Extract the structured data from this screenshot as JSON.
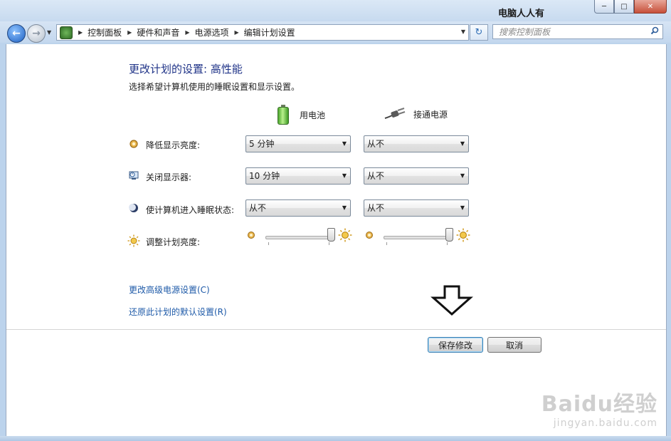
{
  "window": {
    "watermark_title": "电脑人人有",
    "controls": {
      "minimize": "─",
      "maximize": "□",
      "close": "✕"
    }
  },
  "nav": {
    "back_icon": "back-arrow-icon",
    "forward_icon": "forward-arrow-icon",
    "breadcrumbs": [
      "控制面板",
      "硬件和声音",
      "电源选项",
      "编辑计划设置"
    ],
    "search_placeholder": "搜索控制面板"
  },
  "page": {
    "title": "更改计划的设置: 高性能",
    "subtitle": "选择希望计算机使用的睡眠设置和显示设置。",
    "columns": {
      "battery": {
        "label": "用电池",
        "icon": "battery-icon"
      },
      "plugged": {
        "label": "接通电源",
        "icon": "plug-icon"
      }
    },
    "settings": [
      {
        "label": "降低显示亮度:",
        "icon": "dim-brightness-icon",
        "battery": "5 分钟",
        "plugged": "从不"
      },
      {
        "label": "关闭显示器:",
        "icon": "monitor-clock-icon",
        "battery": "10 分钟",
        "plugged": "从不"
      },
      {
        "label": "使计算机进入睡眠状态:",
        "icon": "moon-sleep-icon",
        "battery": "从不",
        "plugged": "从不"
      }
    ],
    "brightness": {
      "label": "调整计划亮度:",
      "icon": "sun-icon",
      "battery_level": 1.0,
      "plugged_level": 1.0
    },
    "links": {
      "advanced": "更改高级电源设置(C)",
      "restore": "还原此计划的默认设置(R)"
    },
    "buttons": {
      "save": "保存修改",
      "cancel": "取消"
    }
  },
  "watermark": {
    "logo": "Baidu经验",
    "url": "jingyan.baidu.com"
  },
  "colors": {
    "title": "#1e3287",
    "link": "#1e5aa8",
    "accent": "#1c5fc2"
  }
}
